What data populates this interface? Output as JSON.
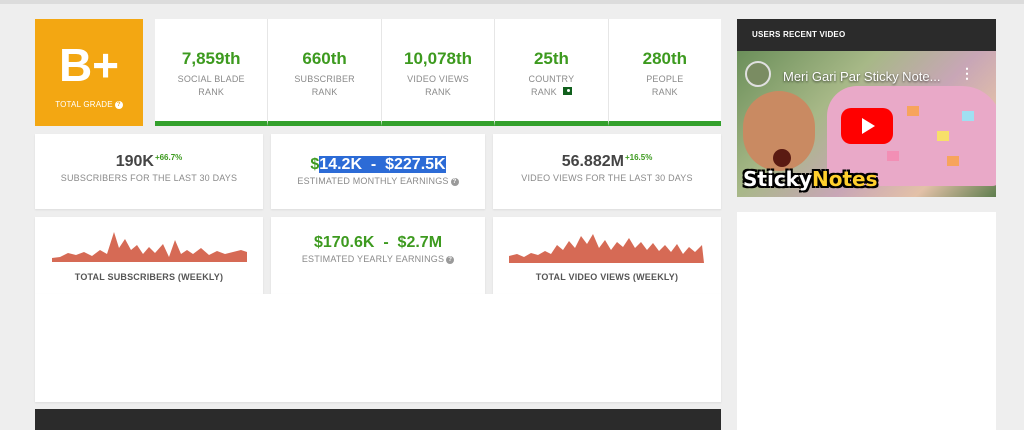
{
  "grade": {
    "value": "B+",
    "label": "TOTAL GRADE",
    "help": "?"
  },
  "ranks": [
    {
      "value": "7,859th",
      "line1": "SOCIAL BLADE",
      "line2": "RANK"
    },
    {
      "value": "660th",
      "line1": "SUBSCRIBER",
      "line2": "RANK"
    },
    {
      "value": "10,078th",
      "line1": "VIDEO VIEWS",
      "line2": "RANK"
    },
    {
      "value": "25th",
      "line1": "COUNTRY",
      "line2": "RANK",
      "flag": "pakistan-flag-icon"
    },
    {
      "value": "280th",
      "line1": "PEOPLE",
      "line2": "RANK"
    }
  ],
  "stats": {
    "subscribers": {
      "value": "190K",
      "delta": "+66.7%",
      "label": "SUBSCRIBERS FOR THE LAST 30 DAYS"
    },
    "monthly": {
      "dollar": "$",
      "range": "14.2K  -  $227.5K",
      "label": "ESTIMATED MONTHLY EARNINGS",
      "help": "?"
    },
    "views": {
      "value": "56.882M",
      "delta": "+16.5%",
      "label": "VIDEO VIEWS FOR THE LAST 30 DAYS"
    },
    "yearly": {
      "range": "$170.6K  -  $2.7M",
      "label": "ESTIMATED YEARLY EARNINGS",
      "help": "?"
    }
  },
  "charts": {
    "subscribers_label": "TOTAL SUBSCRIBERS (WEEKLY)",
    "views_label": "TOTAL VIDEO VIEWS (WEEKLY)",
    "color": "#d66a55"
  },
  "sidebar": {
    "heading": "USERS RECENT VIDEO",
    "video_title": "Meri Gari Par Sticky Note...",
    "menu": "⋮",
    "caption_a": "Sticky",
    "caption_b": "Notes"
  },
  "colors": {
    "grade": "#f3a712",
    "green": "#3d9a1f",
    "highlight": "#2c6bd6"
  }
}
